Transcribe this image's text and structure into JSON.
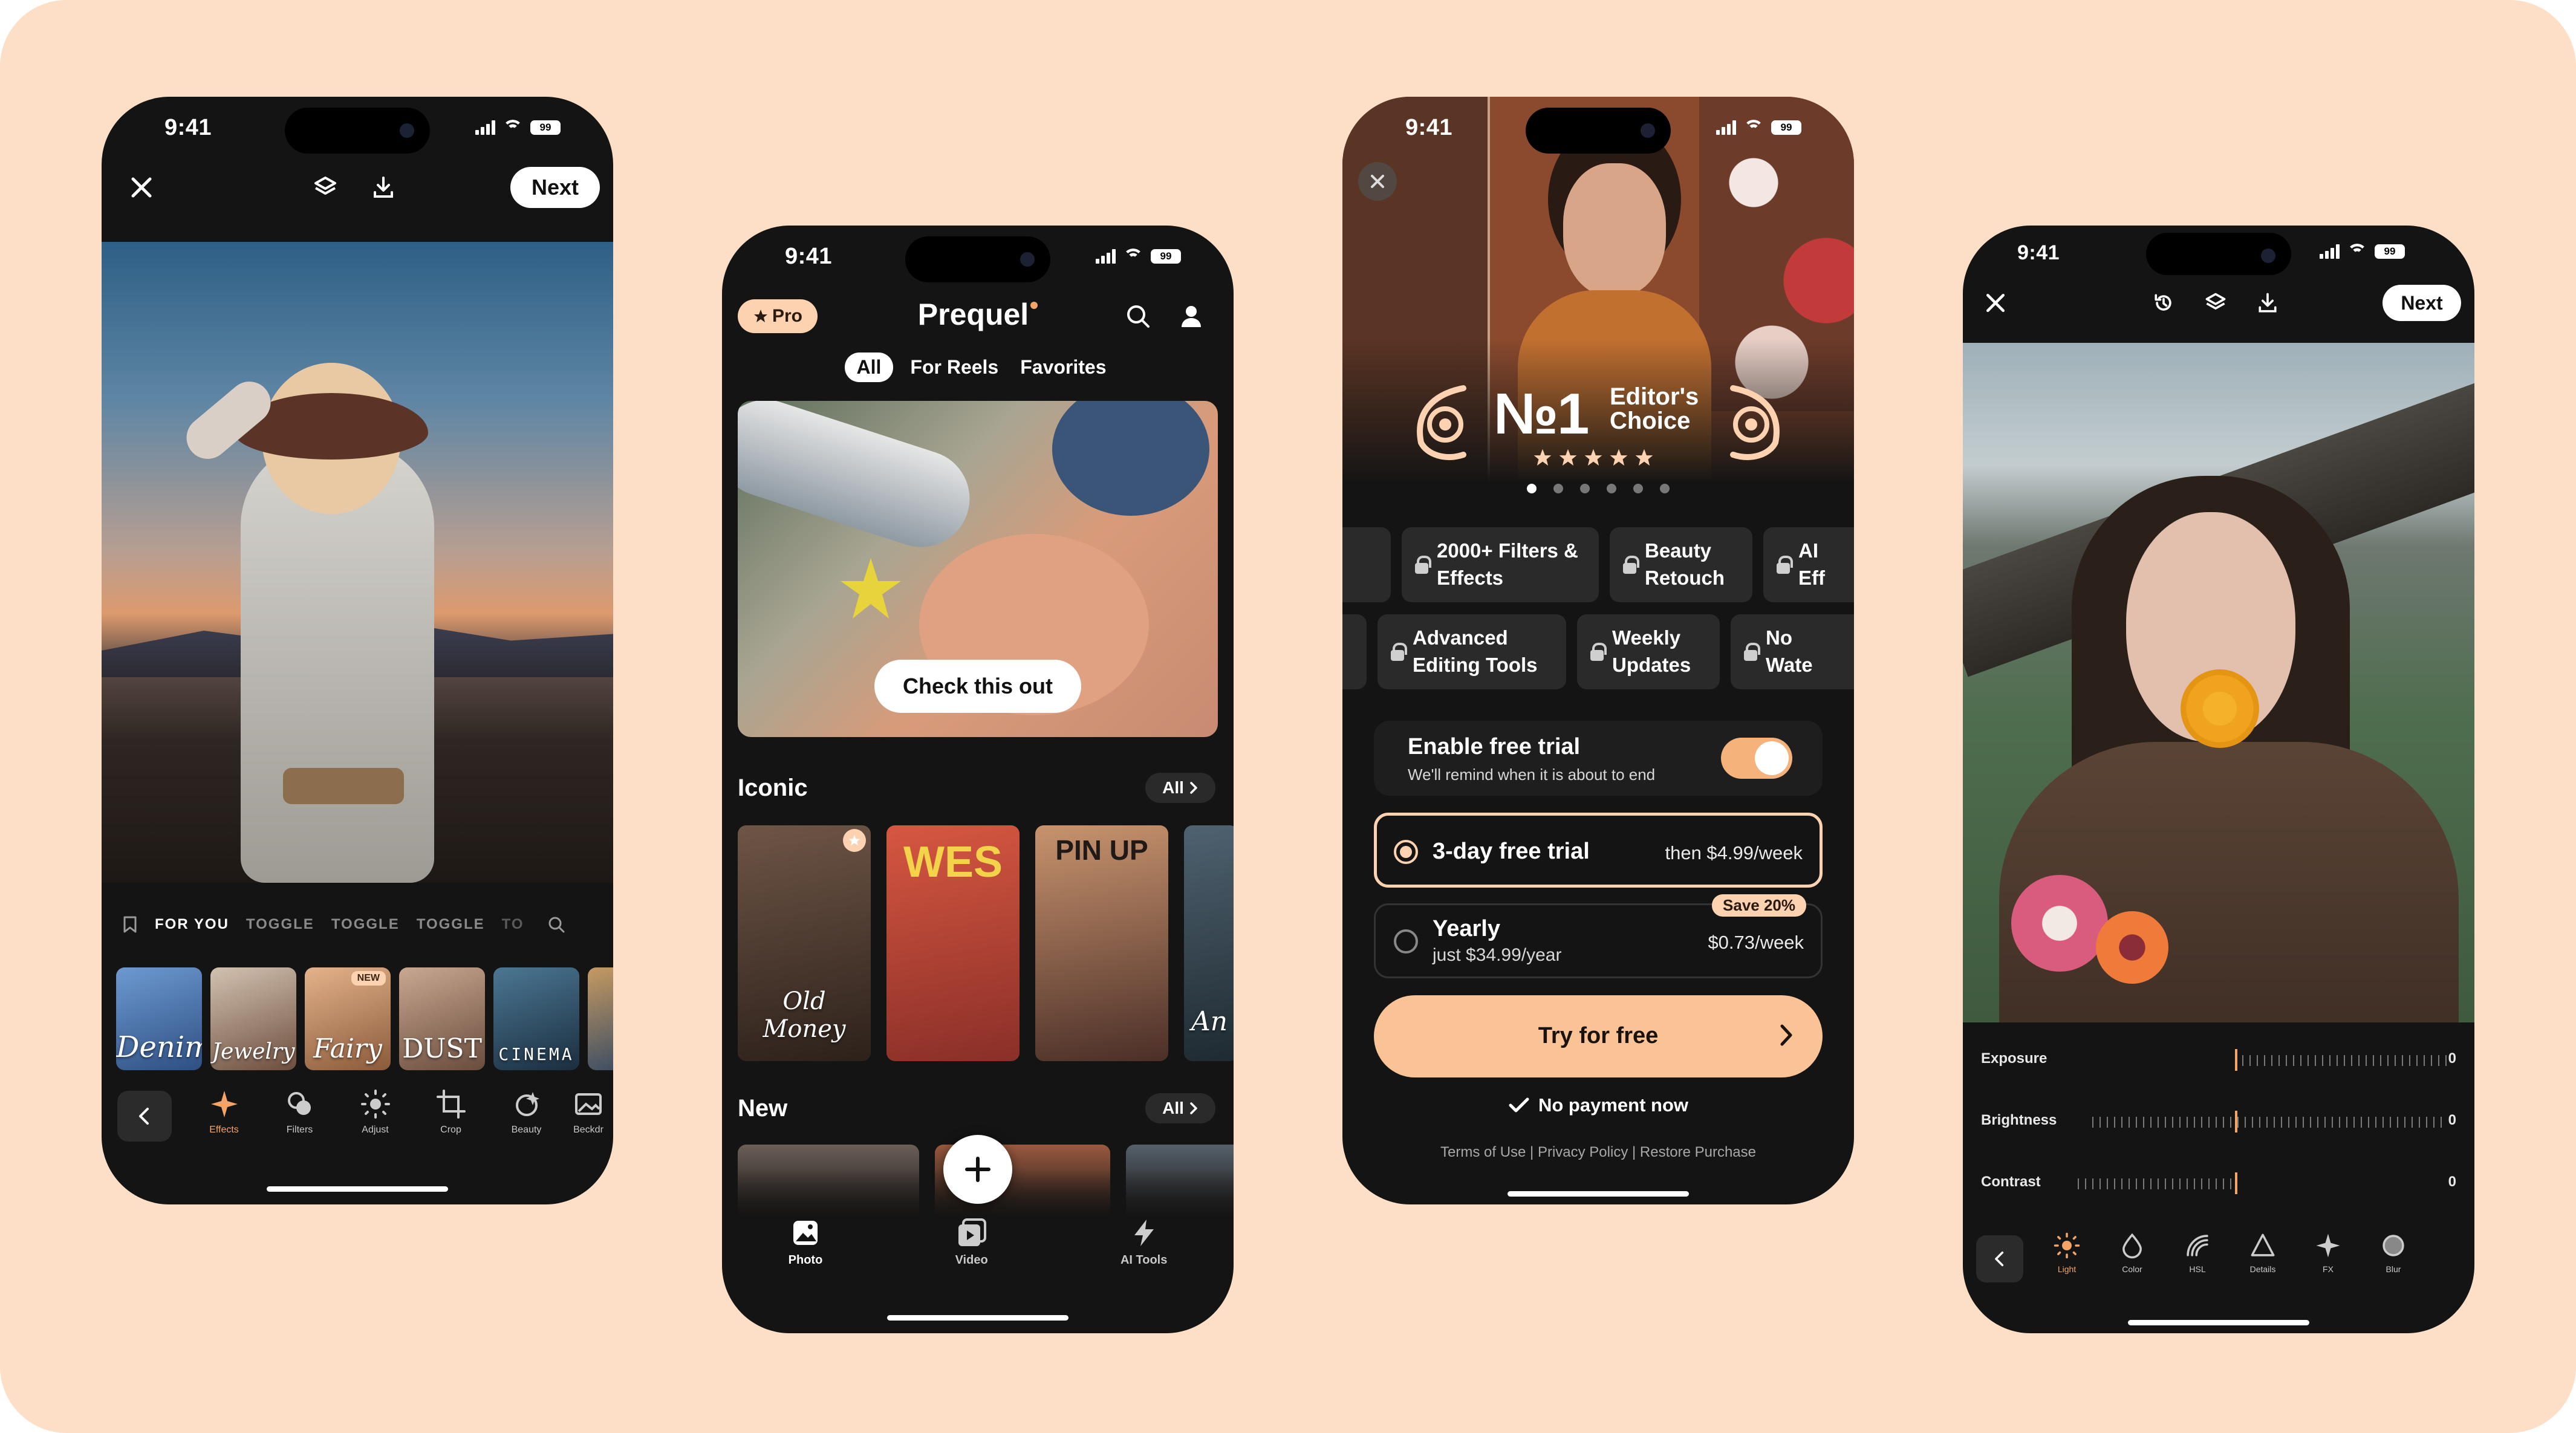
{
  "colors": {
    "background": "#fddfc7",
    "phone": "#141414",
    "accent": "#f5a465",
    "accent_light": "#fcd2b0",
    "toggle_on": "#f5b27a"
  },
  "status": {
    "time": "9:41",
    "battery": "99"
  },
  "phone1": {
    "next_label": "Next",
    "tabs": [
      "FOR YOU",
      "TOGGLE",
      "TOGGLE",
      "TOGGLE",
      "TO"
    ],
    "thumbs": [
      {
        "label": "Denim",
        "color": "#3f6fa6"
      },
      {
        "label": "Jewelry",
        "color": "#8a6a58"
      },
      {
        "label": "Fairy",
        "color": "#c08c66",
        "badge": "NEW"
      },
      {
        "label": "DUST",
        "color": "#a78169"
      },
      {
        "label": "CINEMA",
        "color": "#2d4a62"
      }
    ],
    "tools": [
      {
        "icon": "sparkle-icon",
        "label": "Effects"
      },
      {
        "icon": "filters-icon",
        "label": "Filters"
      },
      {
        "icon": "adjust-icon",
        "label": "Adjust"
      },
      {
        "icon": "crop-icon",
        "label": "Crop"
      },
      {
        "icon": "beauty-icon",
        "label": "Beauty"
      },
      {
        "icon": "background-icon",
        "label": "Beckdr"
      }
    ]
  },
  "phone2": {
    "pro_label": "Pro",
    "app_title": "Prequel",
    "tabs": [
      "All",
      "For Reels",
      "Favorites"
    ],
    "hero_button": "Check this out",
    "sections": [
      {
        "title": "Iconic",
        "all_label": "All"
      },
      {
        "title": "New",
        "all_label": "All"
      }
    ],
    "iconic_cards": [
      {
        "label": "Old Money",
        "color": "#5a4034"
      },
      {
        "label": "WES",
        "color": "#c7423a"
      },
      {
        "label": "PIN UP",
        "color": "#b8765a"
      },
      {
        "label": "An",
        "color": "#3b4b55"
      }
    ],
    "nav": [
      {
        "icon": "photo-icon",
        "label": "Photo"
      },
      {
        "icon": "video-icon",
        "label": "Video"
      },
      {
        "icon": "ai-tools-icon",
        "label": "AI Tools"
      }
    ]
  },
  "phone3": {
    "award_number": "№1",
    "award_text": "Editor's Choice",
    "features_row1": [
      "2000+ Filters & Effects",
      "Beauty Retouch",
      "AI Eff"
    ],
    "features_row2": [
      "Advanced Editing Tools",
      "Weekly Updates",
      "No Wate"
    ],
    "trial_title": "Enable free trial",
    "trial_subtitle": "We'll remind when it is about to end",
    "plans": [
      {
        "name": "3-day free trial",
        "price": "then $4.99/week",
        "selected": true
      },
      {
        "name": "Yearly",
        "sub": "just $34.99/year",
        "price": "$0.73/week",
        "badge": "Save 20%",
        "selected": false
      }
    ],
    "cta": "Try for free",
    "no_payment": "No payment now",
    "footer": "Terms of Use | Privacy Policy | Restore Purchase"
  },
  "phone4": {
    "next_label": "Next",
    "sliders": [
      {
        "label": "Exposure",
        "value": "0"
      },
      {
        "label": "Brightness",
        "value": "0"
      },
      {
        "label": "Contrast",
        "value": "0"
      }
    ],
    "tools": [
      {
        "icon": "light-icon",
        "label": "Light"
      },
      {
        "icon": "color-icon",
        "label": "Color"
      },
      {
        "icon": "hsl-icon",
        "label": "HSL"
      },
      {
        "icon": "details-icon",
        "label": "Details"
      },
      {
        "icon": "fx-icon",
        "label": "FX"
      },
      {
        "icon": "blur-icon",
        "label": "Blur"
      }
    ]
  }
}
